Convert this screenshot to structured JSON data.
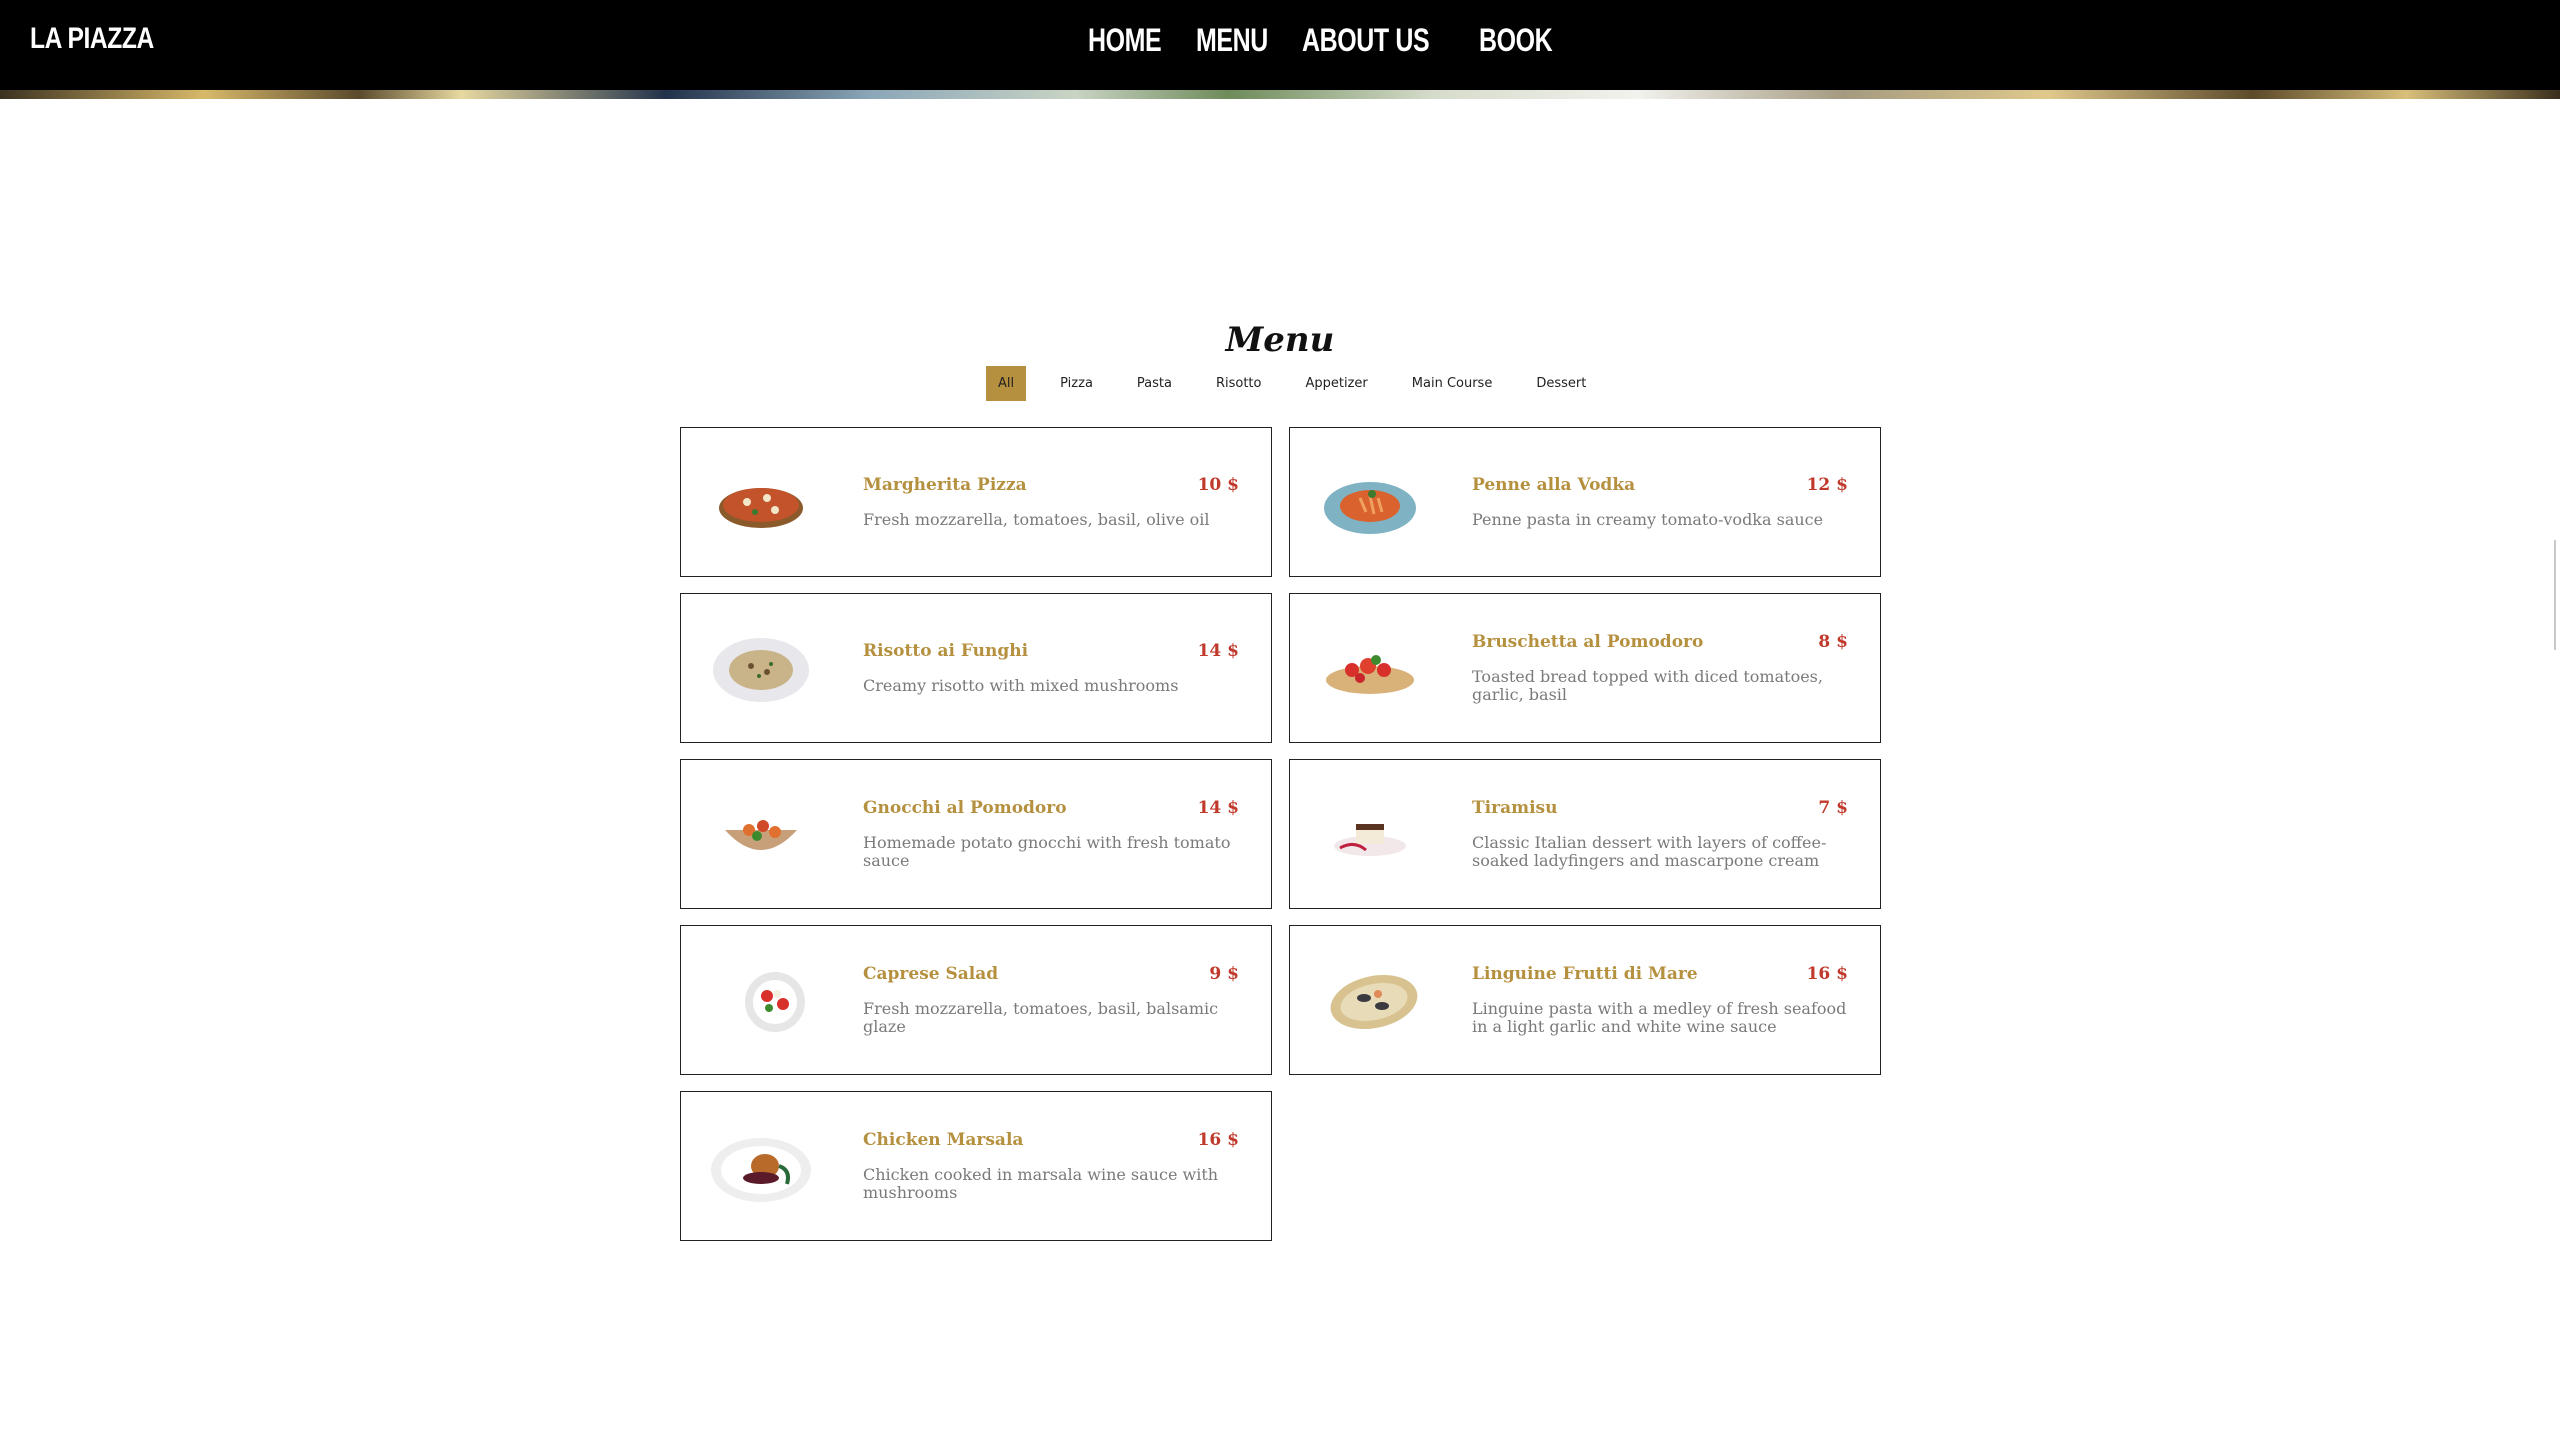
{
  "nav": {
    "brand": "LA PIAZZA",
    "links": [
      "HOME",
      "MENU",
      "ABOUT US",
      "BOOK"
    ]
  },
  "menu": {
    "title": "Menu",
    "filters": [
      "All",
      "Pizza",
      "Pasta",
      "Risotto",
      "Appetizer",
      "Main Course",
      "Dessert"
    ],
    "active_filter": "All",
    "items": [
      {
        "name": "Margherita Pizza",
        "price": "10 $",
        "desc": "Fresh mozzarella, tomatoes, basil, olive oil",
        "icon": "pizza-image"
      },
      {
        "name": "Penne alla Vodka",
        "price": "12 $",
        "desc": "Penne pasta in creamy tomato-vodka sauce",
        "icon": "pasta-image"
      },
      {
        "name": "Risotto ai Funghi",
        "price": "14 $",
        "desc": "Creamy risotto with mixed mushrooms",
        "icon": "risotto-image"
      },
      {
        "name": "Bruschetta al Pomodoro",
        "price": "8 $",
        "desc": "Toasted bread topped with diced tomatoes, garlic, basil",
        "icon": "bruschetta-image"
      },
      {
        "name": "Gnocchi al Pomodoro",
        "price": "14 $",
        "desc": "Homemade potato gnocchi with fresh tomato sauce",
        "icon": "gnocchi-image"
      },
      {
        "name": "Tiramisu",
        "price": "7 $",
        "desc": "Classic Italian dessert with layers of coffee-soaked ladyfingers and mascarpone cream",
        "icon": "tiramisu-image"
      },
      {
        "name": "Caprese Salad",
        "price": "9 $",
        "desc": "Fresh mozzarella, tomatoes, basil, balsamic glaze",
        "icon": "salad-image"
      },
      {
        "name": "Linguine Frutti di Mare",
        "price": "16 $",
        "desc": "Linguine pasta with a medley of fresh seafood in a light garlic and white wine sauce",
        "icon": "seafood-pasta-image"
      },
      {
        "name": "Chicken Marsala",
        "price": "16 $",
        "desc": "Chicken cooked in marsala wine sauce with mushrooms",
        "icon": "chicken-image"
      }
    ]
  },
  "colors": {
    "accent": "#b5903f",
    "price": "#c0392b",
    "nav_bg": "#000000"
  }
}
